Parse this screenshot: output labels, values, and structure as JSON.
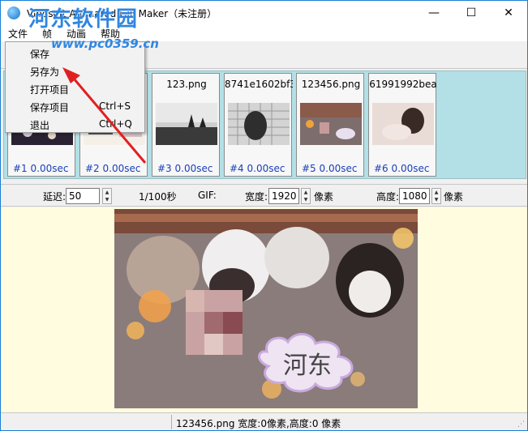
{
  "window": {
    "title": "Vibosoft Animated GIF Maker（未注册）",
    "controls": {
      "minimize": "—",
      "maximize": "☐",
      "close": "✕"
    }
  },
  "watermark": {
    "text": "河东软件园",
    "url": "www.pc0359.cn"
  },
  "menubar": {
    "items": [
      "文件",
      "帧",
      "动画",
      "帮助"
    ]
  },
  "file_menu": {
    "items": [
      {
        "label": "保存",
        "shortcut": ""
      },
      {
        "label": "另存为",
        "shortcut": ""
      },
      {
        "label": "打开项目",
        "shortcut": ""
      },
      {
        "label": "保存项目",
        "shortcut": "Ctrl+S"
      },
      {
        "label": "退出",
        "shortcut": "Ctrl+Q"
      }
    ]
  },
  "frames": [
    {
      "name": "",
      "info": "#1  0.00sec"
    },
    {
      "name": "",
      "info": "#2  0.00sec"
    },
    {
      "name": "123.png",
      "info": "#3  0.00sec"
    },
    {
      "name": "8741e1602bf3",
      "info": "#4  0.00sec"
    },
    {
      "name": "123456.png",
      "info": "#5  0.00sec"
    },
    {
      "name": "61991992bea",
      "info": "#6  0.00sec"
    }
  ],
  "settings": {
    "delay_label": "延迟:",
    "delay_value": "50",
    "delay_unit": "1/100秒",
    "gif_label": "GIF:",
    "width_label": "宽度:",
    "width_value": "1920",
    "width_unit": "像素",
    "height_label": "高度:",
    "height_value": "1080",
    "height_unit": "像素"
  },
  "preview": {
    "overlay_text": "河东"
  },
  "statusbar": {
    "text": "123456.png 宽度:0像素,高度:0 像素"
  },
  "colors": {
    "frames_bg": "#b2e0e6",
    "preview_bg": "#fffce0",
    "frame_info": "#1a3fb8",
    "arrow": "#e02020",
    "watermark": "#2f86e0"
  }
}
